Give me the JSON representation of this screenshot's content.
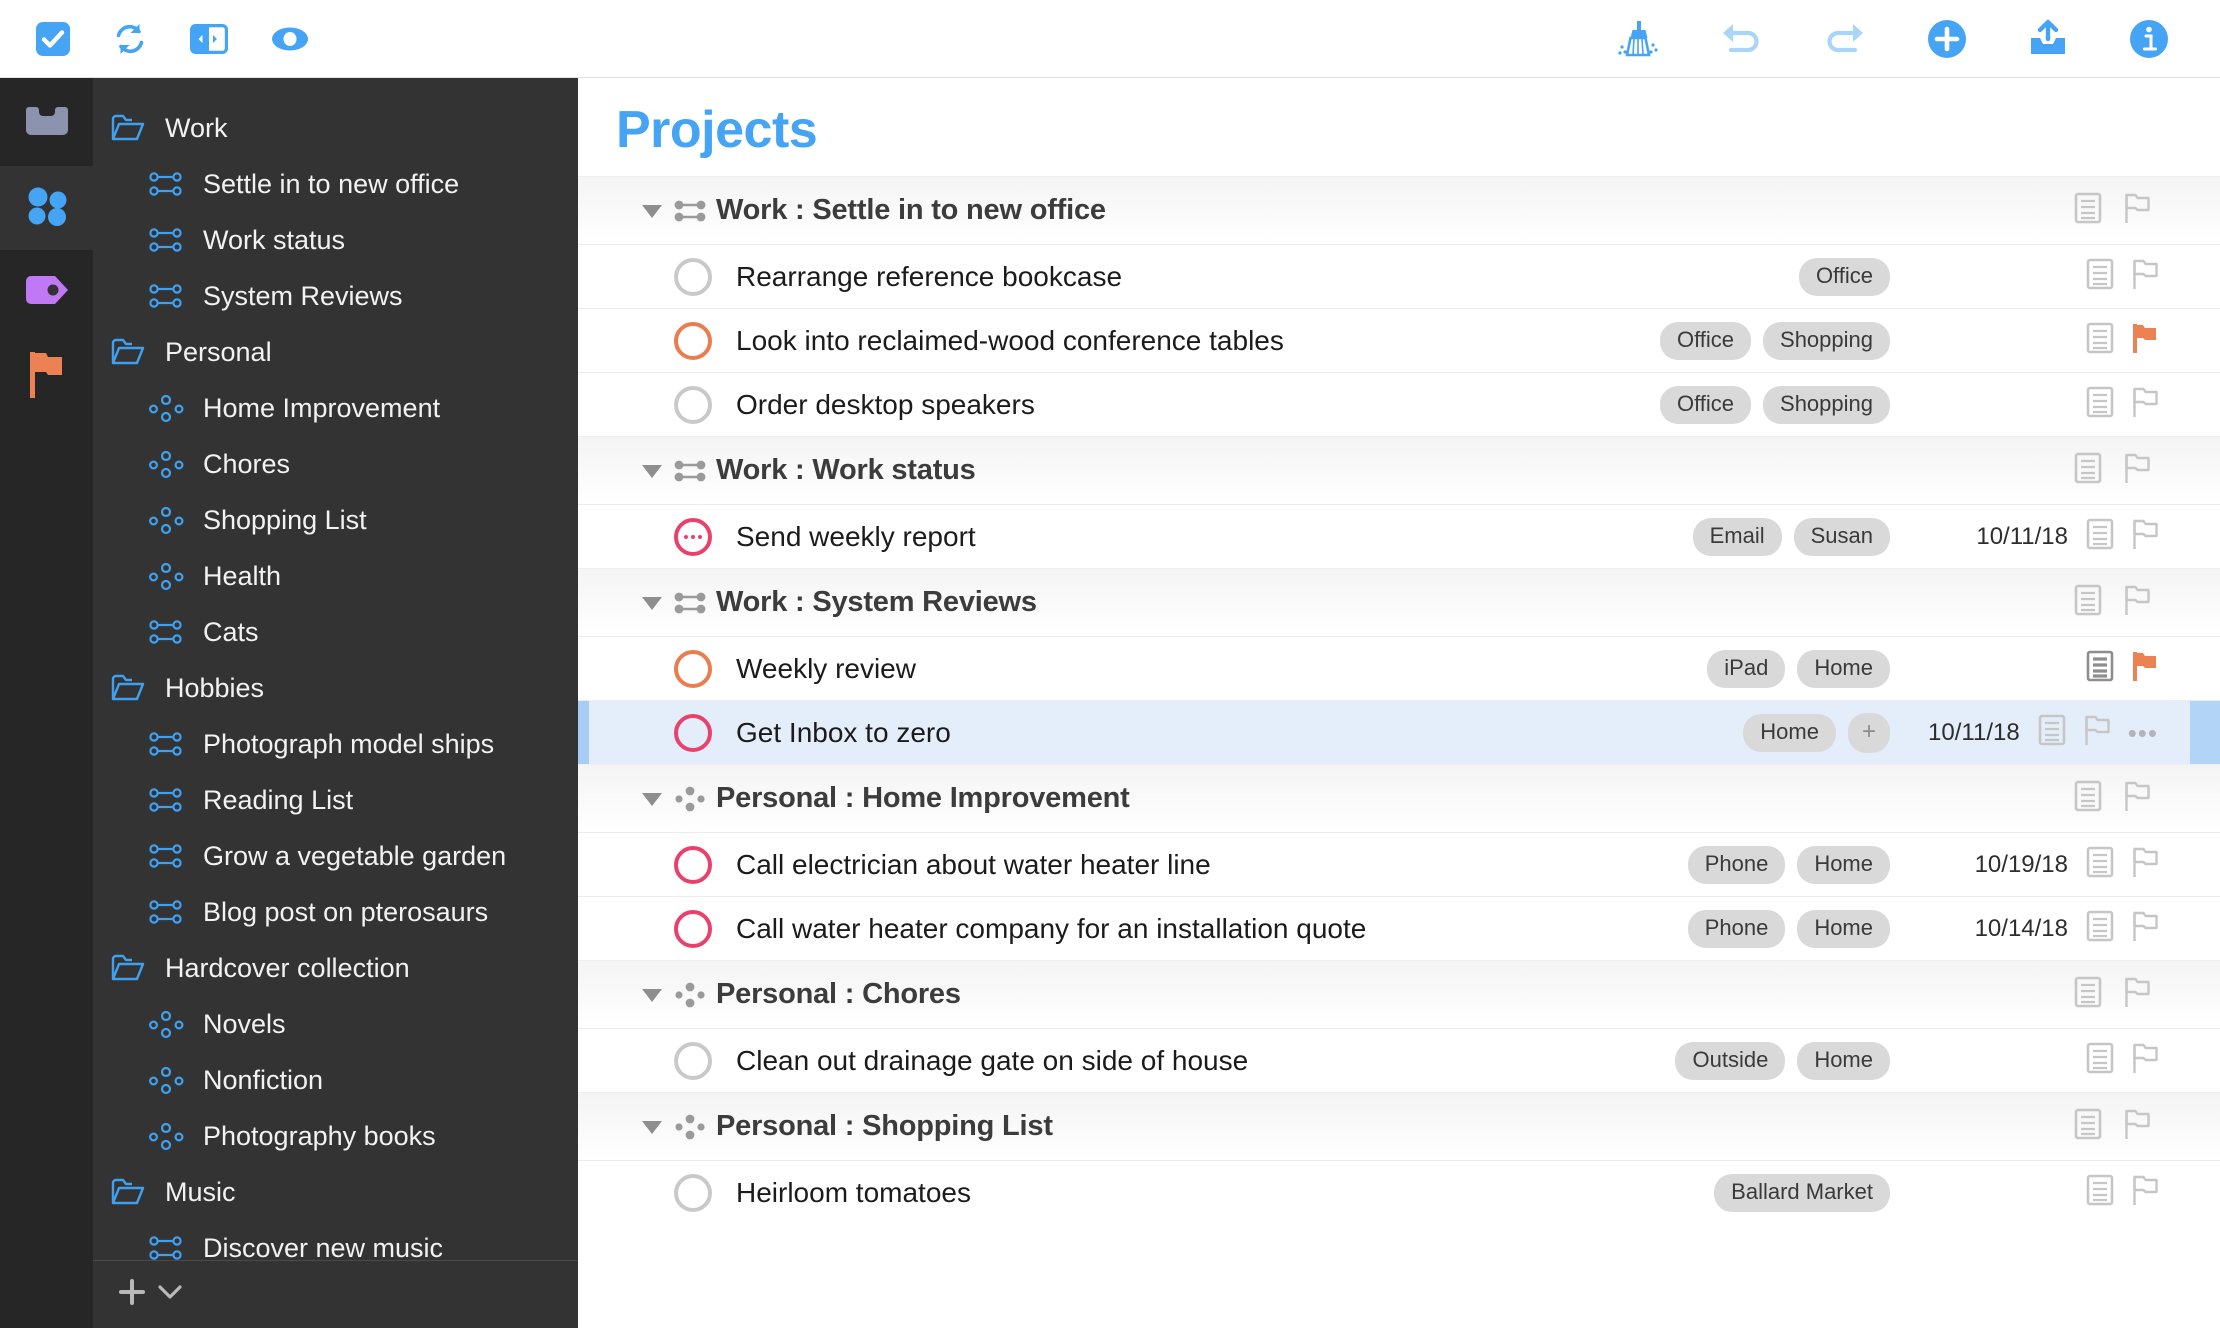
{
  "toolbar": {
    "left": [
      {
        "name": "complete-icon",
        "label": "Complete"
      },
      {
        "name": "sync-icon",
        "label": "Sync"
      },
      {
        "name": "sidebar-toggle-icon",
        "label": "Toggle Sidebar"
      },
      {
        "name": "view-options-icon",
        "label": "View Options"
      }
    ],
    "right": [
      {
        "name": "clean-up-icon",
        "label": "Clean Up"
      },
      {
        "name": "undo-icon",
        "label": "Undo"
      },
      {
        "name": "redo-icon",
        "label": "Redo"
      },
      {
        "name": "add-icon",
        "label": "Add"
      },
      {
        "name": "add-to-inbox-icon",
        "label": "Add to Inbox"
      },
      {
        "name": "inspector-icon",
        "label": "Inspector"
      }
    ]
  },
  "rail": {
    "items": [
      {
        "name": "perspective-inbox",
        "label": "Inbox",
        "icon": "inbox-icon",
        "selected": false
      },
      {
        "name": "perspective-projects",
        "label": "Projects",
        "icon": "projects-icon",
        "selected": true
      },
      {
        "name": "perspective-tags",
        "label": "Tags",
        "icon": "tag-icon",
        "selected": false
      },
      {
        "name": "perspective-flagged",
        "label": "Flagged",
        "icon": "flag-icon",
        "selected": false
      }
    ]
  },
  "sidebar": {
    "items": [
      {
        "label": "Work",
        "type": "folder"
      },
      {
        "label": "Settle in to new office",
        "type": "sequential"
      },
      {
        "label": "Work status",
        "type": "sequential"
      },
      {
        "label": "System Reviews",
        "type": "sequential"
      },
      {
        "label": "Personal",
        "type": "folder"
      },
      {
        "label": "Home Improvement",
        "type": "parallel"
      },
      {
        "label": "Chores",
        "type": "parallel"
      },
      {
        "label": "Shopping List",
        "type": "parallel"
      },
      {
        "label": "Health",
        "type": "parallel"
      },
      {
        "label": "Cats",
        "type": "sequential"
      },
      {
        "label": "Hobbies",
        "type": "folder"
      },
      {
        "label": "Photograph model ships",
        "type": "sequential"
      },
      {
        "label": "Reading List",
        "type": "sequential"
      },
      {
        "label": "Grow a vegetable garden",
        "type": "sequential"
      },
      {
        "label": "Blog post on pterosaurs",
        "type": "sequential"
      },
      {
        "label": "Hardcover collection",
        "type": "folder"
      },
      {
        "label": "Novels",
        "type": "parallel"
      },
      {
        "label": "Nonfiction",
        "type": "parallel"
      },
      {
        "label": "Photography books",
        "type": "parallel"
      },
      {
        "label": "Music",
        "type": "folder"
      },
      {
        "label": "Discover new music",
        "type": "sequential"
      }
    ],
    "bottom": {
      "add_label": "+",
      "menu_label": "⌄",
      "add_name": "add-item-button",
      "menu_name": "add-menu-chevron-icon"
    }
  },
  "main": {
    "title": "Projects",
    "groups": [
      {
        "title": "Work : Settle in to new office",
        "icon": "sequential-icon",
        "expanded": true,
        "tasks": [
          {
            "title": "Rearrange reference bookcase",
            "status": "none",
            "tags": [
              "Office"
            ],
            "due": "",
            "note": "empty",
            "flag": "off",
            "selected": false
          },
          {
            "title": "Look into reclaimed-wood conference tables",
            "status": "available",
            "tags": [
              "Office",
              "Shopping"
            ],
            "due": "",
            "note": "empty",
            "flag": "on",
            "selected": false
          },
          {
            "title": "Order desktop speakers",
            "status": "none",
            "tags": [
              "Office",
              "Shopping"
            ],
            "due": "",
            "note": "empty",
            "flag": "off",
            "selected": false
          }
        ]
      },
      {
        "title": "Work : Work status",
        "icon": "sequential-icon",
        "expanded": true,
        "tasks": [
          {
            "title": "Send weekly report",
            "status": "repeating",
            "tags": [
              "Email",
              "Susan"
            ],
            "due": "10/11/18",
            "note": "empty",
            "flag": "off",
            "selected": false
          }
        ]
      },
      {
        "title": "Work : System Reviews",
        "icon": "sequential-icon",
        "expanded": true,
        "tasks": [
          {
            "title": "Weekly review",
            "status": "available",
            "tags": [
              "iPad",
              "Home"
            ],
            "due": "",
            "note": "filled",
            "flag": "on",
            "selected": false
          },
          {
            "title": "Get Inbox to zero",
            "status": "due",
            "tags": [
              "Home"
            ],
            "add_tag": "+",
            "due": "10/11/18",
            "note": "empty",
            "flag": "off",
            "selected": true,
            "more": "•••"
          }
        ]
      },
      {
        "title": "Personal : Home Improvement",
        "icon": "parallel-icon",
        "expanded": true,
        "tasks": [
          {
            "title": "Call electrician about water heater line",
            "status": "due",
            "tags": [
              "Phone",
              "Home"
            ],
            "due": "10/19/18",
            "note": "empty",
            "flag": "off",
            "selected": false
          },
          {
            "title": "Call water heater company for an installation quote",
            "status": "due",
            "tags": [
              "Phone",
              "Home"
            ],
            "due": "10/14/18",
            "note": "empty",
            "flag": "off",
            "selected": false
          }
        ]
      },
      {
        "title": "Personal : Chores",
        "icon": "parallel-icon",
        "expanded": true,
        "tasks": [
          {
            "title": "Clean out drainage gate on side of house",
            "status": "none",
            "tags": [
              "Outside",
              "Home"
            ],
            "due": "",
            "note": "empty",
            "flag": "off",
            "selected": false
          }
        ]
      },
      {
        "title": "Personal : Shopping List",
        "icon": "parallel-icon",
        "expanded": true,
        "tasks": [
          {
            "title": "Heirloom tomatoes",
            "status": "none",
            "tags": [
              "Ballard Market"
            ],
            "due": "",
            "note": "empty",
            "flag": "off",
            "selected": false
          }
        ]
      }
    ]
  },
  "colors": {
    "accent_blue": "#46a4f5",
    "flag_orange": "#ea7c4e",
    "due_pink": "#e8426c",
    "sidebar_bg": "#333333",
    "rail_bg": "#262626",
    "selection_blue": "#e4eefb",
    "tag_gray": "#d9d9d9"
  }
}
